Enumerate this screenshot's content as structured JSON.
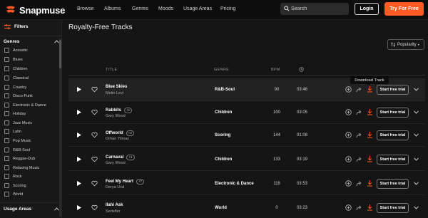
{
  "colors": {
    "accent": "#ff5a23",
    "background": "#151515",
    "nav": "#0d0d0d"
  },
  "nav": {
    "logo_text": "Snapmuse",
    "links": [
      "Browse",
      "Albums",
      "Genres",
      "Moods",
      "Usage Areas",
      "Pricing"
    ],
    "search_placeholder": "Search",
    "login_label": "Login",
    "try_label": "Try For Free"
  },
  "sidebar": {
    "filters_label": "Filters",
    "genres_label": "Genres",
    "genres": [
      "Acoustic",
      "Blues",
      "Children",
      "Classical",
      "Country",
      "Disco-Funk",
      "Electronic & Dance",
      "Holiday",
      "Jazz Music",
      "Latin",
      "Pop Music",
      "R&B-Soul",
      "Reggae-Dub",
      "Relaxing Music",
      "Rock",
      "Scoring",
      "World"
    ],
    "usage_label": "Usage Areas"
  },
  "main": {
    "title": "Royalty-Free Tracks",
    "sort_label": "Popularity",
    "columns": {
      "title": "TITLE",
      "genre": "GENRE",
      "bpm": "BPM"
    },
    "tooltip": "Download Track",
    "trial_label": "Start free trial",
    "tracks": [
      {
        "title": "Blue Skies",
        "artist": "Metin Levi",
        "badge": "",
        "genre": "R&B-Soul",
        "bpm": "90",
        "duration": "03:46"
      },
      {
        "title": "Rabbits",
        "artist": "Gary Wood",
        "badge": "+1",
        "genre": "Children",
        "bpm": "100",
        "duration": "03:05"
      },
      {
        "title": "Offworld",
        "artist": "Orhan Yilmaz",
        "badge": "+3",
        "genre": "Scoring",
        "bpm": "144",
        "duration": "01:08"
      },
      {
        "title": "Carnaval",
        "artist": "Gary Wood",
        "badge": "+1",
        "genre": "Children",
        "bpm": "133",
        "duration": "03:19"
      },
      {
        "title": "Feel My Heart",
        "artist": "Derya Ural",
        "badge": "+7",
        "genre": "Electronic & Dance",
        "bpm": "118",
        "duration": "03:53"
      },
      {
        "title": "Ilahi Ask",
        "artist": "Sedefler",
        "badge": "",
        "genre": "World",
        "bpm": "0",
        "duration": "03:23"
      }
    ]
  }
}
